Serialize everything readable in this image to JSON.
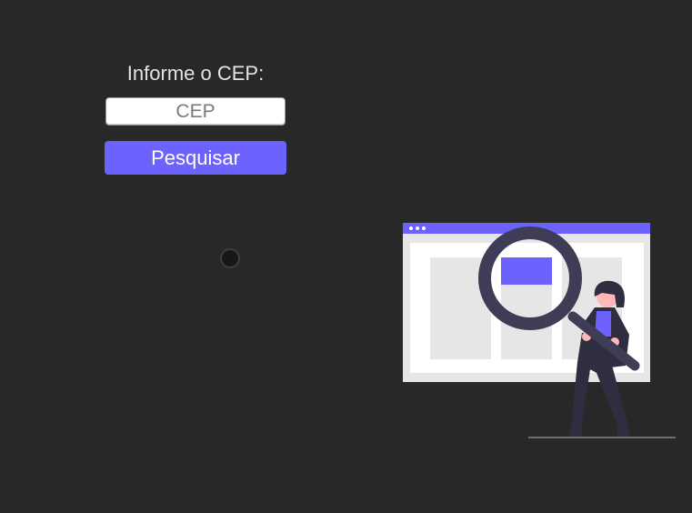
{
  "form": {
    "label": "Informe o CEP:",
    "input_placeholder": "CEP",
    "input_value": "",
    "button_label": "Pesquisar"
  },
  "colors": {
    "background": "#282828",
    "accent": "#6c63ff",
    "text": "#e3e3e3"
  },
  "illustration": {
    "name": "search-illustration",
    "icons": [
      "magnifying-glass-icon",
      "browser-window-icon",
      "person-icon"
    ]
  }
}
